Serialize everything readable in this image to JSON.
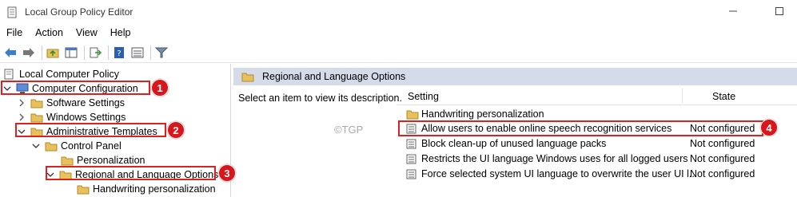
{
  "window": {
    "title": "Local Group Policy Editor"
  },
  "menu": [
    "File",
    "Action",
    "View",
    "Help"
  ],
  "tree": [
    {
      "label": "Local Computer Policy",
      "icon": "policy-icon"
    },
    {
      "label": "Computer Configuration",
      "icon": "computer-icon"
    },
    {
      "label": "Software Settings",
      "icon": "folder-icon"
    },
    {
      "label": "Windows Settings",
      "icon": "folder-icon"
    },
    {
      "label": "Administrative Templates",
      "icon": "folder-icon"
    },
    {
      "label": "Control Panel",
      "icon": "folder-icon"
    },
    {
      "label": "Personalization",
      "icon": "folder-icon"
    },
    {
      "label": "Regional and Language Options",
      "icon": "folder-icon"
    },
    {
      "label": "Handwriting personalization",
      "icon": "folder-icon"
    }
  ],
  "right_panel": {
    "header": "Regional and Language Options",
    "description": "Select an item to view its description.",
    "watermark": "©TGP",
    "columns": {
      "setting": "Setting",
      "state": "State"
    },
    "rows": [
      {
        "name": "Handwriting personalization",
        "state": "",
        "icon": "folder-icon"
      },
      {
        "name": "Allow users to enable online speech recognition services",
        "state": "Not configured",
        "icon": "policy-setting-icon"
      },
      {
        "name": "Block clean-up of unused language packs",
        "state": "Not configured",
        "icon": "policy-setting-icon"
      },
      {
        "name": "Restricts the UI language Windows uses for all logged users",
        "state": "Not configured",
        "icon": "policy-setting-icon"
      },
      {
        "name": "Force selected system UI language to overwrite the user UI l...",
        "state": "Not configured",
        "icon": "policy-setting-icon"
      }
    ]
  },
  "badges": [
    "1",
    "2",
    "3",
    "4"
  ],
  "colors": {
    "highlight": "#e02020",
    "badge": "#d9161c",
    "header_bg": "#d6dbe9",
    "folder": "#e8c15c"
  }
}
